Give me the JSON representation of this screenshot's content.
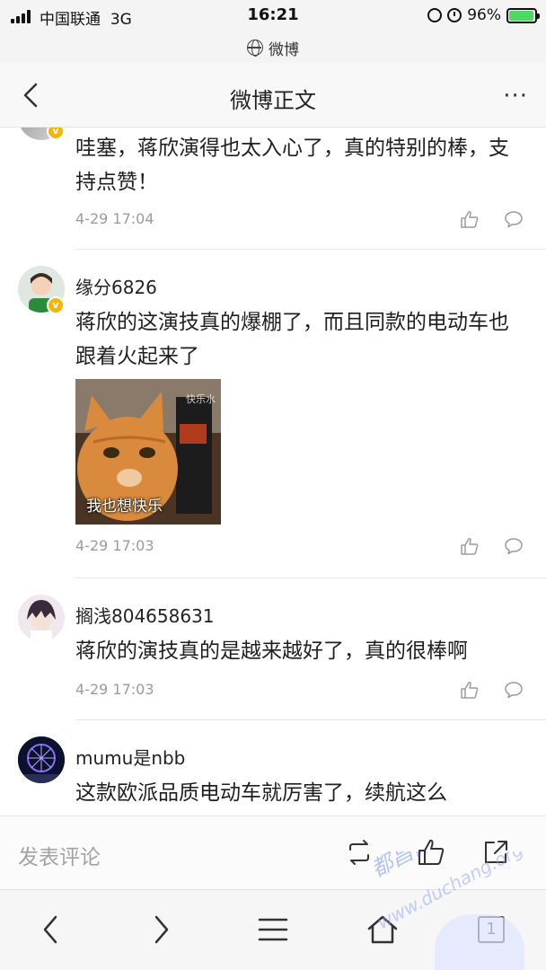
{
  "status_bar": {
    "carrier": "中国联通",
    "network": "3G",
    "time": "16:21",
    "battery_percent": "96%",
    "battery_level": 0.96
  },
  "url_bar": {
    "site": "微博"
  },
  "nav": {
    "title": "微博正文",
    "more": "···"
  },
  "comments": [
    {
      "username": "",
      "text": "哇塞，蒋欣演得也太入心了，真的特别的棒，支持点赞！",
      "time": "4-29 17:04",
      "verified": true
    },
    {
      "username": "缘分6826",
      "text": "蒋欣的这演技真的爆棚了，而且同款的电动车也跟着火起来了",
      "time": "4-29 17:03",
      "verified": true,
      "sticker": {
        "caption": "我也想快乐",
        "mark": "快乐水"
      }
    },
    {
      "username": "搁浅804658631",
      "text": "蒋欣的演技真的是越来越好了，真的很棒啊",
      "time": "4-29 17:03",
      "verified": false
    },
    {
      "username": "mumu是nbb",
      "text": "这款欧派品质电动车就厉害了，续航这么",
      "time": "",
      "verified": false
    }
  ],
  "action_bar": {
    "comment_placeholder": "发表评论"
  },
  "toolbar": {
    "tab_count": "1"
  },
  "watermark": {
    "text": "都昌微",
    "site": "www.duchang.org"
  },
  "colors": {
    "verified_badge": "#f5b40a",
    "battery": "#4cd964",
    "muted_text": "#9b9b9b"
  }
}
